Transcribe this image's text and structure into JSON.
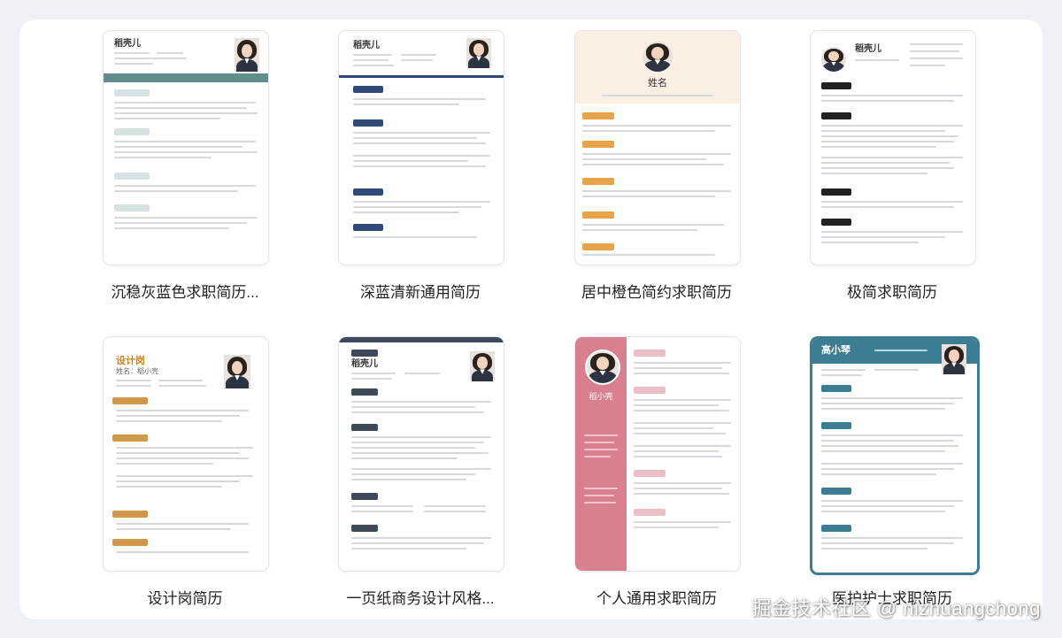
{
  "templates": [
    {
      "caption": "沉稳灰蓝色求职简历...",
      "name": "稻壳儿",
      "accent": "#5f8e8e"
    },
    {
      "caption": "深蓝清新通用简历",
      "name": "稻壳儿",
      "accent": "#2f4a7a"
    },
    {
      "caption": "居中橙色简约求职简历",
      "name": "姓名",
      "accent": "#e8a24a"
    },
    {
      "caption": "极简求职简历",
      "name": "稻壳儿",
      "accent": "#222222"
    },
    {
      "caption": "设计岗简历",
      "name": "设计岗",
      "subname": "姓名：稻小壳",
      "accent": "#c8862a"
    },
    {
      "caption": "一页纸商务设计风格...",
      "name": "稻壳儿",
      "accent": "#3e4a5c"
    },
    {
      "caption": "个人通用求职简历",
      "name": "稻小壳",
      "accent": "#d9808f"
    },
    {
      "caption": "医护护士求职简历",
      "name": "高小琴",
      "accent": "#3c7d93"
    }
  ],
  "watermark": "掘金技术社区 @ nizhuangchong"
}
